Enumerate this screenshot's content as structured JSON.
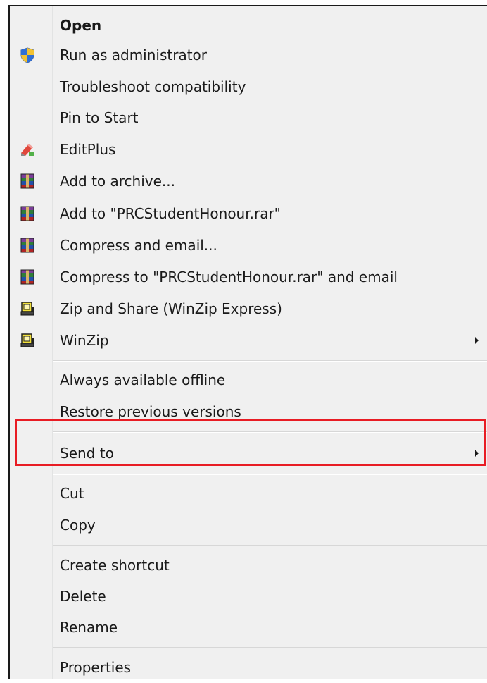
{
  "menu": {
    "items": [
      {
        "label": "Open",
        "bold": true,
        "icon": "",
        "submenu": false
      },
      {
        "label": "Run as administrator",
        "bold": false,
        "icon": "uac-shield-icon",
        "submenu": false
      },
      {
        "label": "Troubleshoot compatibility",
        "bold": false,
        "icon": "",
        "submenu": false
      },
      {
        "label": "Pin to Start",
        "bold": false,
        "icon": "",
        "submenu": false
      },
      {
        "label": "EditPlus",
        "bold": false,
        "icon": "editplus-icon",
        "submenu": false
      },
      {
        "label": "Add to archive...",
        "bold": false,
        "icon": "winrar-icon",
        "submenu": false
      },
      {
        "label": "Add to \"PRCStudentHonour.rar\"",
        "bold": false,
        "icon": "winrar-icon",
        "submenu": false
      },
      {
        "label": "Compress and email...",
        "bold": false,
        "icon": "winrar-icon",
        "submenu": false
      },
      {
        "label": "Compress to \"PRCStudentHonour.rar\" and email",
        "bold": false,
        "icon": "winrar-icon",
        "submenu": false
      },
      {
        "label": "Zip and Share (WinZip Express)",
        "bold": false,
        "icon": "winzip-icon",
        "submenu": false
      },
      {
        "label": "WinZip",
        "bold": false,
        "icon": "winzip-icon",
        "submenu": true
      },
      {
        "label": "Always available offline",
        "bold": false,
        "icon": "",
        "submenu": false
      },
      {
        "label": "Restore previous versions",
        "bold": false,
        "icon": "",
        "submenu": false
      },
      {
        "label": "Send to",
        "bold": false,
        "icon": "",
        "submenu": true,
        "highlighted": true
      },
      {
        "label": "Cut",
        "bold": false,
        "icon": "",
        "submenu": false
      },
      {
        "label": "Copy",
        "bold": false,
        "icon": "",
        "submenu": false
      },
      {
        "label": "Create shortcut",
        "bold": false,
        "icon": "",
        "submenu": false
      },
      {
        "label": "Delete",
        "bold": false,
        "icon": "",
        "submenu": false
      },
      {
        "label": "Rename",
        "bold": false,
        "icon": "",
        "submenu": false
      },
      {
        "label": "Properties",
        "bold": false,
        "icon": "",
        "submenu": false
      }
    ]
  },
  "colors": {
    "menu_background": "#f0f0f0",
    "text": "#1a1a1a",
    "highlight_border": "#e81c24"
  }
}
